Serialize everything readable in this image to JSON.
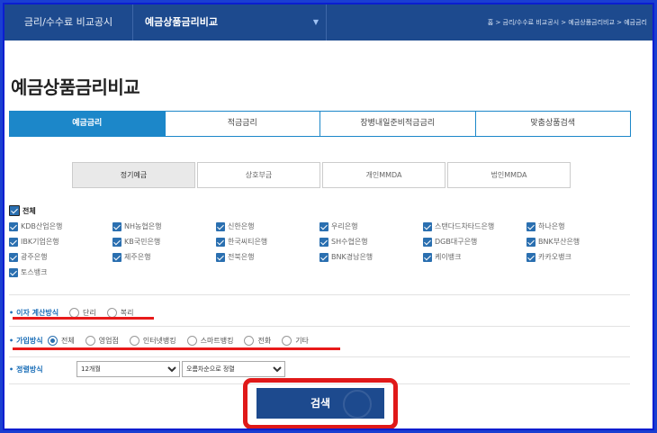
{
  "topbar": {
    "crumb1": "금리/수수료 비교공시",
    "crumb2": "예금상품금리비교",
    "path": "홈 > 금리/수수료 비교공시 > 예금상품금리비교 > 예금금리"
  },
  "page_title": "예금상품금리비교",
  "main_tabs": [
    {
      "label": "예금금리",
      "active": true
    },
    {
      "label": "적금금리",
      "active": false
    },
    {
      "label": "장병내일준비적금금리",
      "active": false
    },
    {
      "label": "맞춤상품검색",
      "active": false
    }
  ],
  "sub_tabs": [
    {
      "label": "정기예금",
      "active": true
    },
    {
      "label": "상호부금",
      "active": false
    },
    {
      "label": "개인MMDA",
      "active": false
    },
    {
      "label": "법인MMDA",
      "active": false
    }
  ],
  "banks": {
    "all_label": "전체",
    "items": [
      "KDB산업은행",
      "NH농협은행",
      "신한은행",
      "우리은행",
      "스탠다드차타드은행",
      "하나은행",
      "IBK기업은행",
      "KB국민은행",
      "한국씨티은행",
      "SH수협은행",
      "DGB대구은행",
      "BNK부산은행",
      "광주은행",
      "제주은행",
      "전북은행",
      "BNK경남은행",
      "케이뱅크",
      "카카오뱅크",
      "토스뱅크"
    ]
  },
  "interest_calc": {
    "label": "이자 계산방식",
    "options": [
      "단리",
      "복리"
    ]
  },
  "join_method": {
    "label": "가입방식",
    "options": [
      "전체",
      "영업점",
      "인터넷뱅킹",
      "스마트뱅킹",
      "전화",
      "기타"
    ],
    "selected": "전체"
  },
  "sort_method": {
    "label": "정렬방식",
    "period": "12개월",
    "order": "오름차순으로 정렬"
  },
  "search_label": "검색",
  "colors": {
    "nav": "#1d4a8e",
    "tab_active": "#1c87c9",
    "highlight": "#e81a1a"
  }
}
